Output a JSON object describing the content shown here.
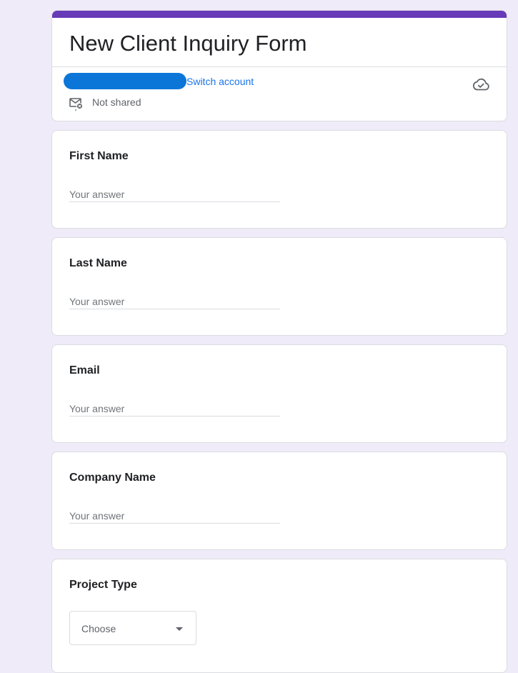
{
  "form": {
    "title": "New Client Inquiry Form",
    "accent_color": "#673ab7",
    "background_color": "#f0ebf8"
  },
  "account": {
    "switch_label": "Switch account",
    "redaction_color": "#0b76d8",
    "sharing_status": "Not shared"
  },
  "icons": {
    "save_status": "cloud-check-icon",
    "sharing": "mail-not-shared-icon"
  },
  "questions": [
    {
      "label": "First Name",
      "placeholder": "Your answer"
    },
    {
      "label": "Last Name",
      "placeholder": "Your answer"
    },
    {
      "label": "Email",
      "placeholder": "Your answer"
    },
    {
      "label": "Company Name",
      "placeholder": "Your answer"
    }
  ],
  "project_type": {
    "label": "Project Type",
    "selected": "Choose"
  }
}
